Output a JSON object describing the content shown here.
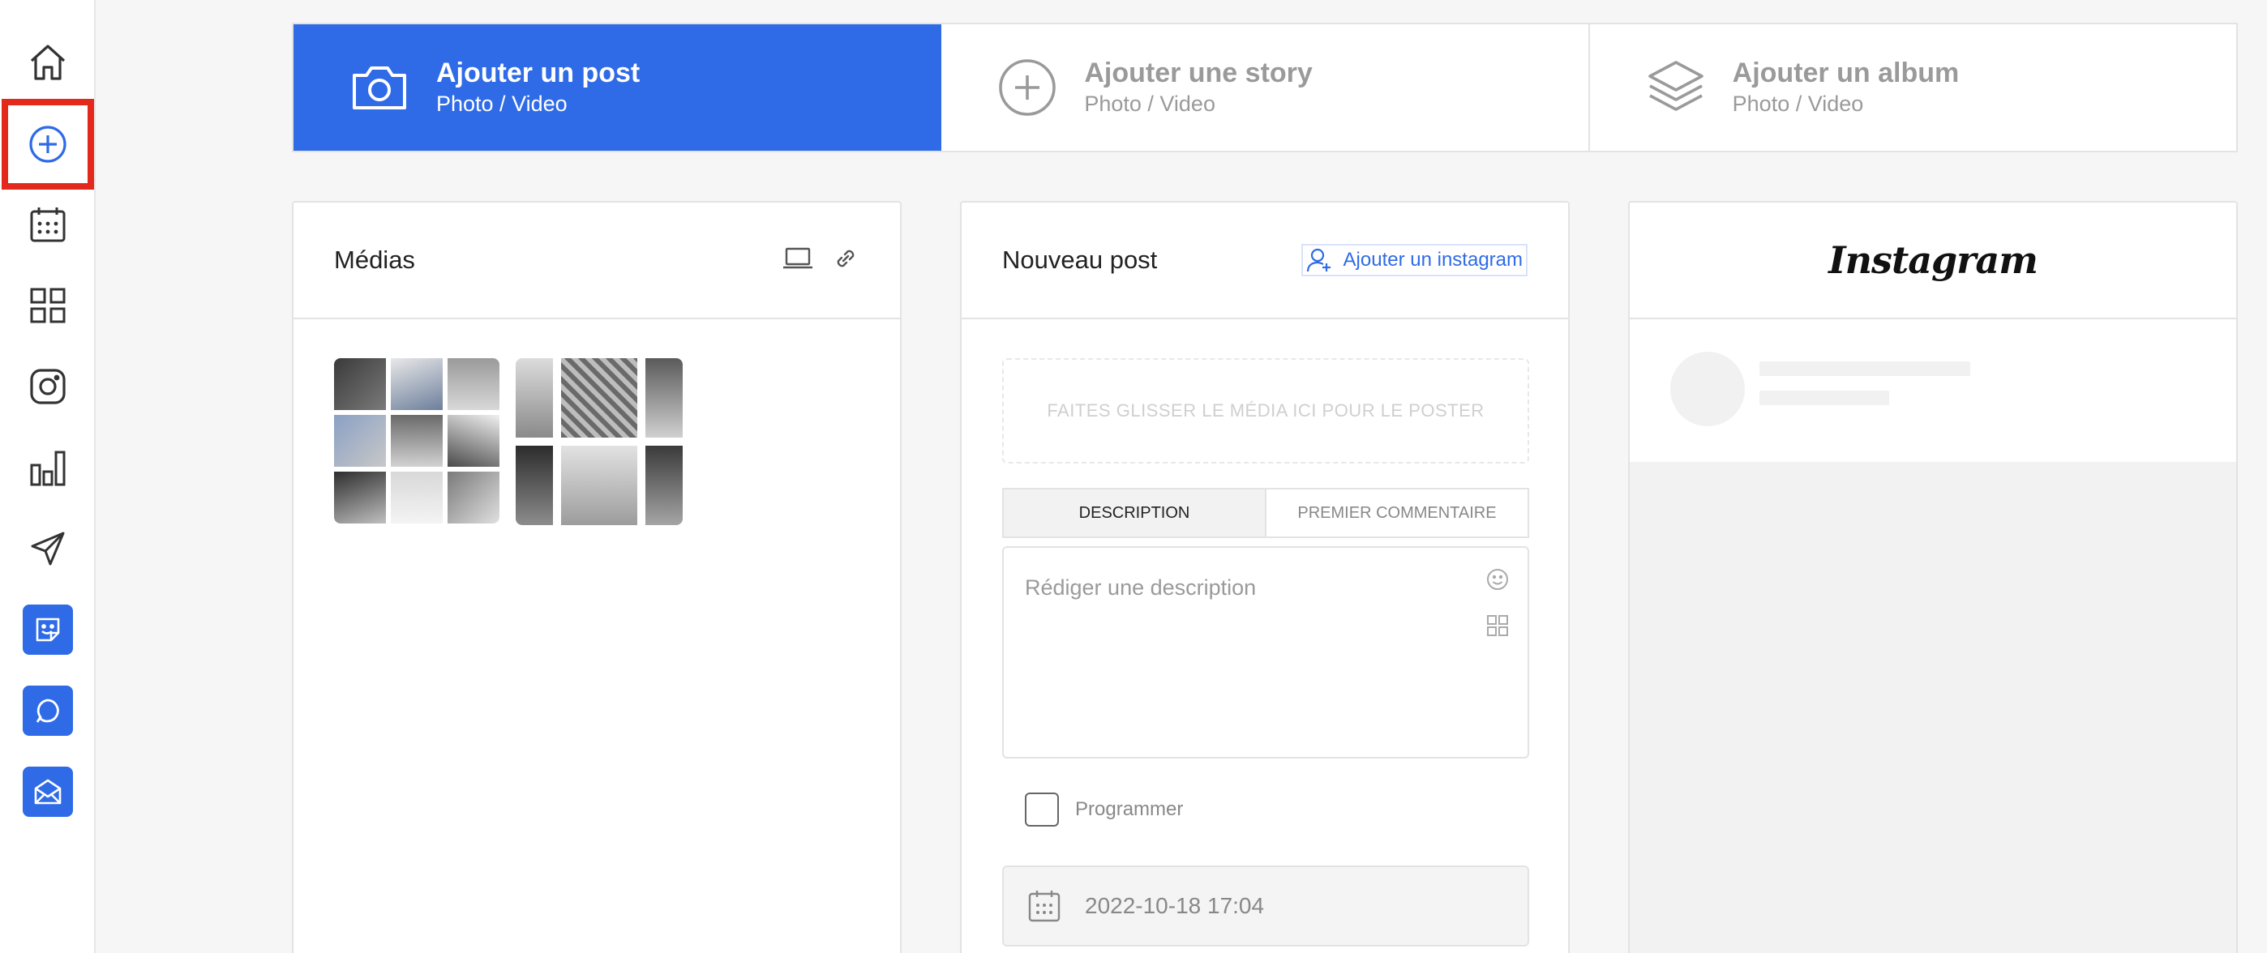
{
  "sidebar": {
    "items": [
      {
        "name": "home-icon"
      },
      {
        "name": "add-circle-icon",
        "selected": true
      },
      {
        "name": "calendar-icon"
      },
      {
        "name": "grid-icon"
      },
      {
        "name": "instagram-icon"
      },
      {
        "name": "stats-icon"
      },
      {
        "name": "send-icon"
      },
      {
        "name": "sticker-icon"
      },
      {
        "name": "chat-icon"
      },
      {
        "name": "mail-icon"
      }
    ],
    "selected_color": "#e3291b",
    "accent_color": "#2f6be6"
  },
  "tabs": [
    {
      "title": "Ajouter un post",
      "subtitle": "Photo / Video",
      "icon": "camera-icon",
      "active": true
    },
    {
      "title": "Ajouter une story",
      "subtitle": "Photo / Video",
      "icon": "add-circle-icon",
      "active": false
    },
    {
      "title": "Ajouter un album",
      "subtitle": "Photo / Video",
      "icon": "layers-icon",
      "active": false
    }
  ],
  "medias": {
    "title": "Médias",
    "icons": [
      "laptop-icon",
      "link-icon"
    ]
  },
  "post": {
    "title": "Nouveau post",
    "add_instagram": "Ajouter un instagram",
    "dropzone": "FAITES GLISSER LE MÉDIA ICI POUR LE POSTER",
    "tabs": [
      "DESCRIPTION",
      "PREMIER COMMENTAIRE"
    ],
    "description_placeholder": "Rédiger une description",
    "schedule_label": "Programmer",
    "date_value": "2022-10-18 17:04"
  },
  "preview": {
    "logo": "Instagram"
  }
}
